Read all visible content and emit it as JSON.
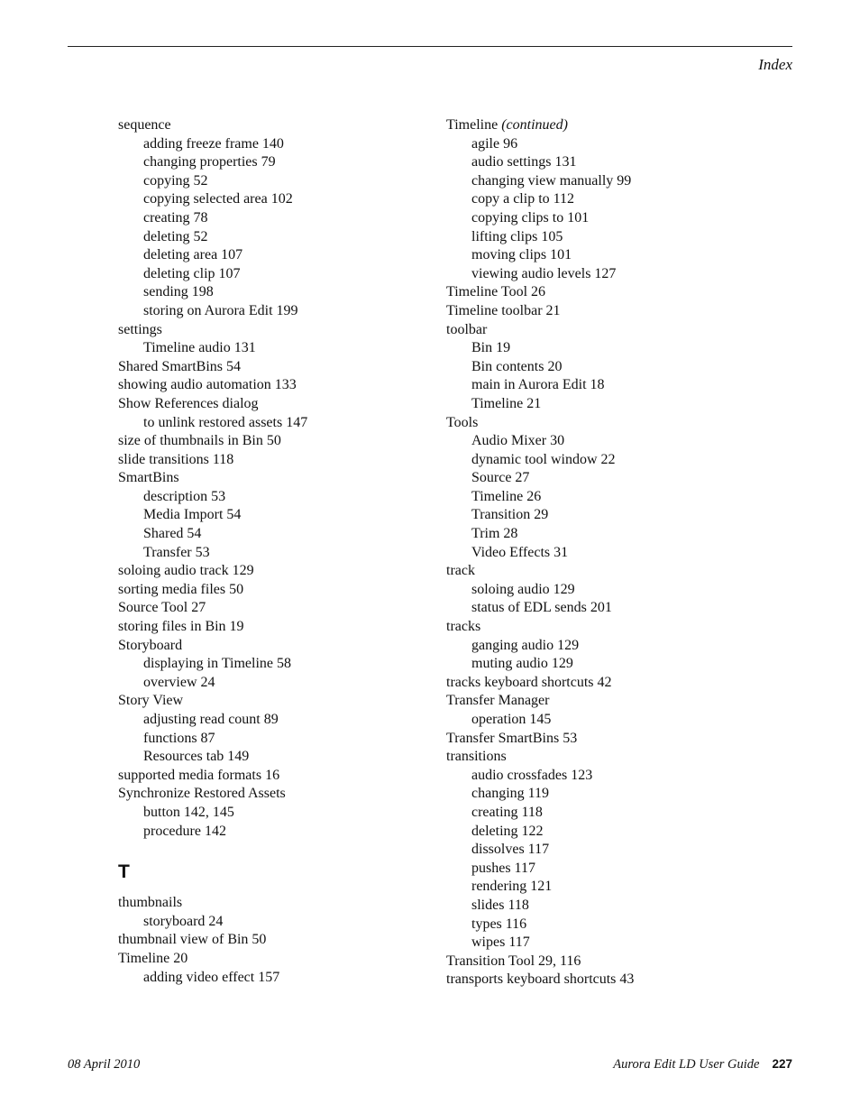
{
  "header": {
    "section_title": "Index"
  },
  "left_column": [
    {
      "text": "sequence",
      "level": 0
    },
    {
      "text": "adding freeze frame 140",
      "level": 1
    },
    {
      "text": "changing properties 79",
      "level": 1
    },
    {
      "text": "copying 52",
      "level": 1
    },
    {
      "text": "copying selected area 102",
      "level": 1
    },
    {
      "text": "creating 78",
      "level": 1
    },
    {
      "text": "deleting 52",
      "level": 1
    },
    {
      "text": "deleting area 107",
      "level": 1
    },
    {
      "text": "deleting clip 107",
      "level": 1
    },
    {
      "text": "sending 198",
      "level": 1
    },
    {
      "text": "storing on Aurora Edit 199",
      "level": 1
    },
    {
      "text": "settings",
      "level": 0
    },
    {
      "text": "Timeline audio 131",
      "level": 1
    },
    {
      "text": "Shared SmartBins 54",
      "level": 0
    },
    {
      "text": "showing audio automation 133",
      "level": 0
    },
    {
      "text": "Show References dialog",
      "level": 0
    },
    {
      "text": "to unlink restored assets 147",
      "level": 1
    },
    {
      "text": "size of thumbnails in Bin 50",
      "level": 0
    },
    {
      "text": "slide transitions 118",
      "level": 0
    },
    {
      "text": "SmartBins",
      "level": 0
    },
    {
      "text": "description 53",
      "level": 1
    },
    {
      "text": "Media Import 54",
      "level": 1
    },
    {
      "text": "Shared 54",
      "level": 1
    },
    {
      "text": "Transfer 53",
      "level": 1
    },
    {
      "text": "soloing audio track 129",
      "level": 0
    },
    {
      "text": "sorting media files 50",
      "level": 0
    },
    {
      "text": "Source Tool 27",
      "level": 0
    },
    {
      "text": "storing files in Bin 19",
      "level": 0
    },
    {
      "text": "Storyboard",
      "level": 0
    },
    {
      "text": "displaying in Timeline 58",
      "level": 1
    },
    {
      "text": "overview 24",
      "level": 1
    },
    {
      "text": "Story View",
      "level": 0
    },
    {
      "text": "adjusting read count 89",
      "level": 1
    },
    {
      "text": "functions 87",
      "level": 1
    },
    {
      "text": "Resources tab 149",
      "level": 1
    },
    {
      "text": "supported media formats 16",
      "level": 0
    },
    {
      "text": "Synchronize Restored Assets",
      "level": 0
    },
    {
      "text": "button 142, 145",
      "level": 1
    },
    {
      "text": "procedure 142",
      "level": 1
    },
    {
      "letter": "T"
    },
    {
      "text": "thumbnails",
      "level": 0
    },
    {
      "text": "storyboard 24",
      "level": 1
    },
    {
      "text": "thumbnail view of Bin 50",
      "level": 0
    },
    {
      "text": "Timeline 20",
      "level": 0
    },
    {
      "text": "adding video effect 157",
      "level": 1
    }
  ],
  "right_column": [
    {
      "text": "Timeline ",
      "cont": "(continued)",
      "level": 0
    },
    {
      "text": "agile 96",
      "level": 1
    },
    {
      "text": "audio settings 131",
      "level": 1
    },
    {
      "text": "changing view manually 99",
      "level": 1
    },
    {
      "text": "copy a clip to 112",
      "level": 1
    },
    {
      "text": "copying clips to 101",
      "level": 1
    },
    {
      "text": "lifting clips 105",
      "level": 1
    },
    {
      "text": "moving clips 101",
      "level": 1
    },
    {
      "text": "viewing audio levels 127",
      "level": 1
    },
    {
      "text": "Timeline Tool 26",
      "level": 0
    },
    {
      "text": "Timeline toolbar 21",
      "level": 0
    },
    {
      "text": "toolbar",
      "level": 0
    },
    {
      "text": "Bin 19",
      "level": 1
    },
    {
      "text": "Bin contents 20",
      "level": 1
    },
    {
      "text": "main in Aurora Edit 18",
      "level": 1
    },
    {
      "text": "Timeline 21",
      "level": 1
    },
    {
      "text": "Tools",
      "level": 0
    },
    {
      "text": "Audio Mixer 30",
      "level": 1
    },
    {
      "text": "dynamic tool window 22",
      "level": 1
    },
    {
      "text": "Source 27",
      "level": 1
    },
    {
      "text": "Timeline 26",
      "level": 1
    },
    {
      "text": "Transition 29",
      "level": 1
    },
    {
      "text": "Trim 28",
      "level": 1
    },
    {
      "text": "Video Effects 31",
      "level": 1
    },
    {
      "text": "track",
      "level": 0
    },
    {
      "text": "soloing audio 129",
      "level": 1
    },
    {
      "text": "status of EDL sends 201",
      "level": 1
    },
    {
      "text": "tracks",
      "level": 0
    },
    {
      "text": "ganging audio 129",
      "level": 1
    },
    {
      "text": "muting audio 129",
      "level": 1
    },
    {
      "text": "tracks keyboard shortcuts 42",
      "level": 0
    },
    {
      "text": "Transfer Manager",
      "level": 0
    },
    {
      "text": "operation 145",
      "level": 1
    },
    {
      "text": "Transfer SmartBins 53",
      "level": 0
    },
    {
      "text": "transitions",
      "level": 0
    },
    {
      "text": "audio crossfades 123",
      "level": 1
    },
    {
      "text": "changing 119",
      "level": 1
    },
    {
      "text": "creating 118",
      "level": 1
    },
    {
      "text": "deleting 122",
      "level": 1
    },
    {
      "text": "dissolves 117",
      "level": 1
    },
    {
      "text": "pushes 117",
      "level": 1
    },
    {
      "text": "rendering 121",
      "level": 1
    },
    {
      "text": "slides 118",
      "level": 1
    },
    {
      "text": "types 116",
      "level": 1
    },
    {
      "text": "wipes 117",
      "level": 1
    },
    {
      "text": "Transition Tool 29, 116",
      "level": 0
    },
    {
      "text": "transports keyboard shortcuts 43",
      "level": 0
    }
  ],
  "footer": {
    "date": "08 April 2010",
    "guide_title": "Aurora Edit LD User Guide",
    "page_number": "227"
  }
}
